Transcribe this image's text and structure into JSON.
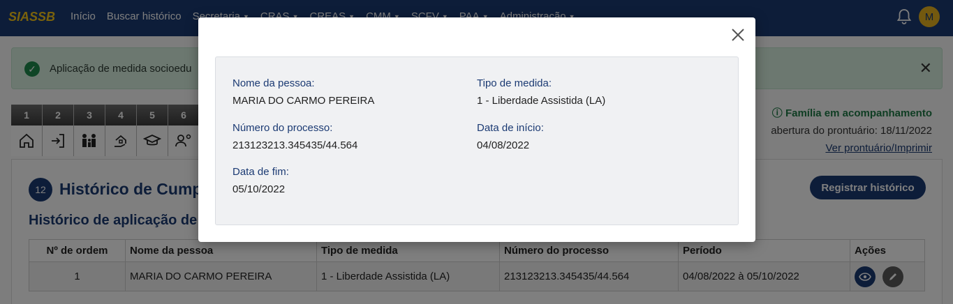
{
  "app": {
    "brand": "SIASSB"
  },
  "nav": {
    "items": [
      {
        "label": "Início",
        "caret": false
      },
      {
        "label": "Buscar histórico",
        "caret": false
      },
      {
        "label": "Secretaria",
        "caret": true
      },
      {
        "label": "CRAS",
        "caret": true
      },
      {
        "label": "CREAS",
        "caret": true
      },
      {
        "label": "CMM",
        "caret": true
      },
      {
        "label": "SCFV",
        "caret": true
      },
      {
        "label": "PAA",
        "caret": true
      },
      {
        "label": "Administração",
        "caret": true
      }
    ],
    "avatar_initial": "M"
  },
  "alert": {
    "message": "Aplicação de medida socioedu"
  },
  "steps": [
    {
      "num": "1",
      "icon": "home-icon"
    },
    {
      "num": "2",
      "icon": "login-icon"
    },
    {
      "num": "3",
      "icon": "family-icon"
    },
    {
      "num": "4",
      "icon": "house-hand-icon"
    },
    {
      "num": "5",
      "icon": "graduation-cap-icon"
    },
    {
      "num": "6",
      "icon": "user-gear-icon"
    }
  ],
  "status": {
    "family": "Família em acompanhamento",
    "opening": "abertura do prontuário: 18/11/2022",
    "link": "Ver prontuário/Imprimir"
  },
  "card": {
    "badge": "12",
    "title": "Histórico de Cump",
    "register_button": "Registrar histórico",
    "subtitle": "Histórico de aplicação de"
  },
  "table": {
    "headers": [
      "Nº de ordem",
      "Nome da pessoa",
      "Tipo de medida",
      "Número do processo",
      "Período",
      "Ações"
    ],
    "rows": [
      [
        "1",
        "MARIA DO CARMO PEREIRA",
        "1 - Liberdade Assistida (LA)",
        "213123213.345435/44.564",
        "04/08/2022 à 05/10/2022"
      ]
    ]
  },
  "modal": {
    "nome_label": "Nome da pessoa:",
    "nome_value": "MARIA DO CARMO PEREIRA",
    "tipo_label": "Tipo de medida:",
    "tipo_value": "1 - Liberdade Assistida (LA)",
    "processo_label": "Número do processo:",
    "processo_value": "213123213.345435/44.564",
    "inicio_label": "Data de início:",
    "inicio_value": "04/08/2022",
    "fim_label": "Data de fim:",
    "fim_value": "05/10/2022"
  }
}
